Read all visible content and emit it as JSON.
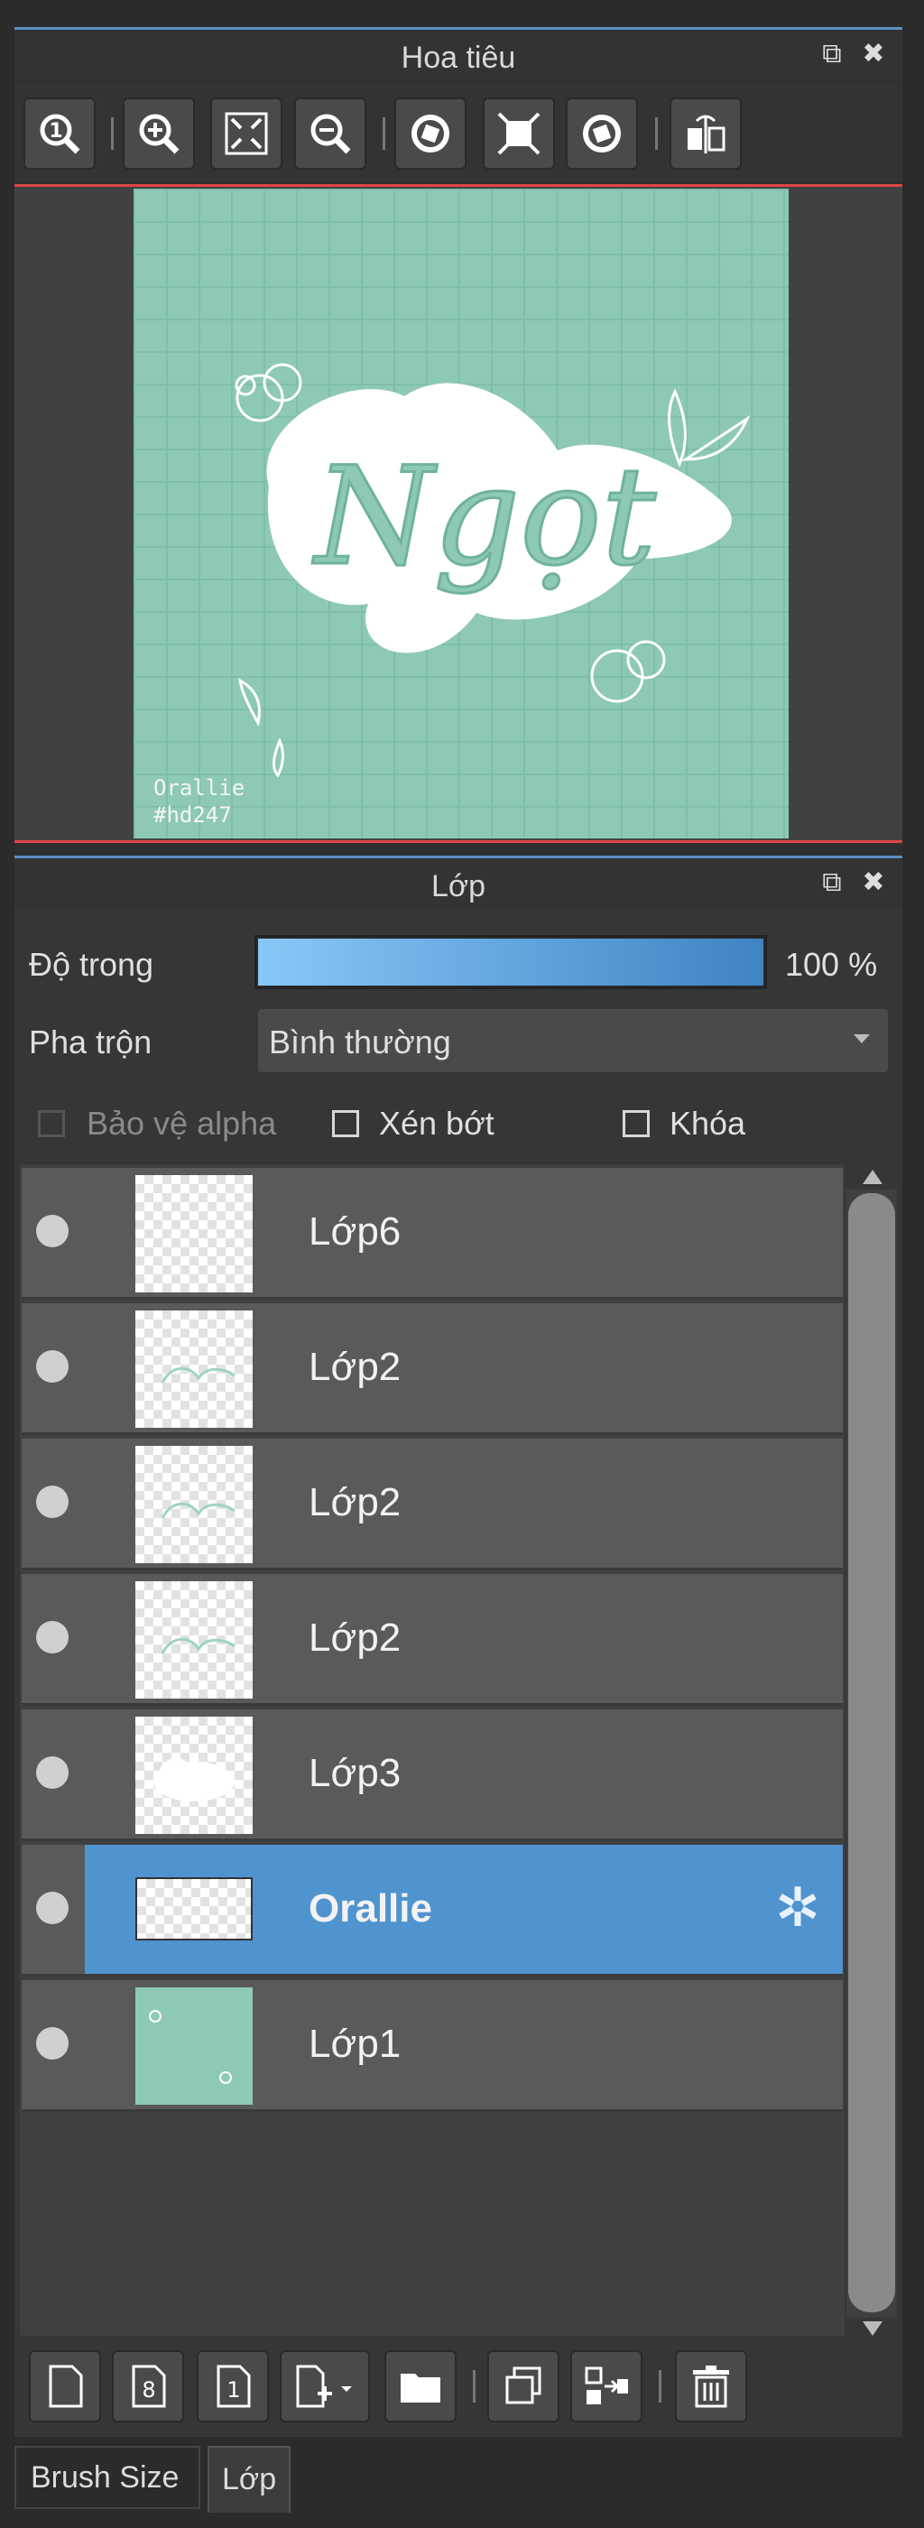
{
  "navigator": {
    "title": "Hoa tiêu",
    "toolbar": [
      "zoom-reset-icon",
      "zoom-in-icon",
      "fit-screen-icon",
      "zoom-out-icon",
      "rotate-left-icon",
      "fit-canvas-icon",
      "rotate-right-icon",
      "flip-icon"
    ],
    "canvas": {
      "artwork_text": "Ngọt",
      "signature_line1": "Orallie",
      "signature_line2": "#hd247",
      "bg_color": "#8dc9b5"
    }
  },
  "layers_panel": {
    "title": "Lớp",
    "opacity_label": "Độ trong",
    "opacity_value": "100 %",
    "opacity_fraction": 1.0,
    "blend_label": "Pha trộn",
    "blend_value": "Bình thường",
    "protect_alpha": "Bảo vệ alpha",
    "clipping": "Xén bớt",
    "lock": "Khóa",
    "layers": [
      {
        "name": "Lớp6"
      },
      {
        "name": "Lớp2"
      },
      {
        "name": "Lớp2"
      },
      {
        "name": "Lớp2"
      },
      {
        "name": "Lớp3"
      },
      {
        "name": "Orallie",
        "selected": true
      },
      {
        "name": "Lớp1"
      }
    ],
    "bottom_toolbar": [
      "new-layer-icon",
      "new-8bit-layer-icon",
      "new-1bit-layer-icon",
      "add-layer-menu-icon",
      "folder-icon",
      "duplicate-icon",
      "merge-down-icon",
      "delete-icon"
    ]
  },
  "tabs": {
    "brush_size": "Brush Size",
    "layer": "Lớp"
  },
  "colors": {
    "accent": "#4f93cf",
    "panel": "#333333",
    "layer_bg": "#5a5a5a",
    "canvas": "#8dc9b5"
  }
}
